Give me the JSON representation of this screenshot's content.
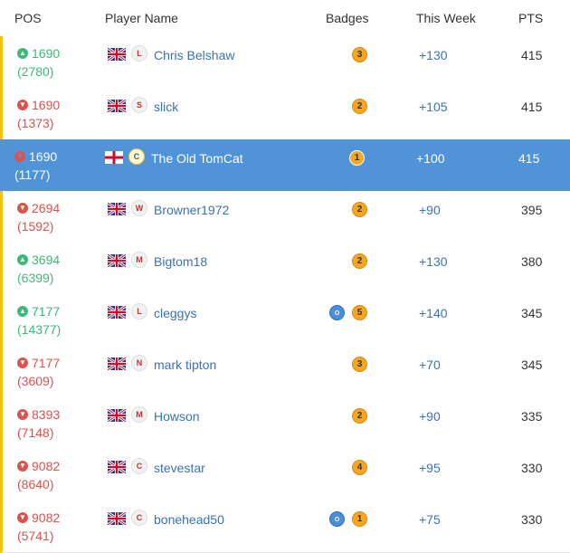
{
  "headers": {
    "pos": "POS",
    "name": "Player Name",
    "badges": "Badges",
    "week": "This Week",
    "pts": "PTS"
  },
  "rows": [
    {
      "pos": "1690",
      "prev": "(2780)",
      "dir": "up",
      "flag": "uk",
      "crest": "liverpool",
      "name": "Chris Belshaw",
      "badge": "3",
      "extra_badge": false,
      "week": "+130",
      "pts": "415",
      "stripe": true,
      "active": false
    },
    {
      "pos": "1690",
      "prev": "(1373)",
      "dir": "down",
      "flag": "uk",
      "crest": "spurs",
      "name": "slick",
      "badge": "2",
      "extra_badge": false,
      "week": "+105",
      "pts": "415",
      "stripe": true,
      "active": false
    },
    {
      "pos": "1690",
      "prev": "(1177)",
      "dir": "down",
      "flag": "england",
      "crest": "club",
      "name": "The Old TomCat",
      "badge": "1",
      "extra_badge": false,
      "week": "+100",
      "pts": "415",
      "stripe": false,
      "active": true
    },
    {
      "pos": "2694",
      "prev": "(1592)",
      "dir": "down",
      "flag": "uk",
      "crest": "westham",
      "name": "Browner1972",
      "badge": "2",
      "extra_badge": false,
      "week": "+90",
      "pts": "395",
      "stripe": true,
      "active": false
    },
    {
      "pos": "3694",
      "prev": "(6399)",
      "dir": "up",
      "flag": "uk",
      "crest": "manutd",
      "name": "Bigtom18",
      "badge": "2",
      "extra_badge": false,
      "week": "+130",
      "pts": "380",
      "stripe": true,
      "active": false
    },
    {
      "pos": "7177",
      "prev": "(14377)",
      "dir": "up",
      "flag": "uk",
      "crest": "liverpool",
      "name": "cleggys",
      "badge": "5",
      "extra_badge": true,
      "week": "+140",
      "pts": "345",
      "stripe": true,
      "active": false
    },
    {
      "pos": "7177",
      "prev": "(3609)",
      "dir": "down",
      "flag": "uk",
      "crest": "forest",
      "name": "mark tipton",
      "badge": "3",
      "extra_badge": false,
      "week": "+70",
      "pts": "345",
      "stripe": true,
      "active": false
    },
    {
      "pos": "8393",
      "prev": "(7148)",
      "dir": "down",
      "flag": "uk",
      "crest": "manutd",
      "name": "Howson",
      "badge": "2",
      "extra_badge": false,
      "week": "+90",
      "pts": "335",
      "stripe": true,
      "active": false
    },
    {
      "pos": "9082",
      "prev": "(8640)",
      "dir": "down",
      "flag": "uk",
      "crest": "cheltenham",
      "name": "stevestar",
      "badge": "4",
      "extra_badge": false,
      "week": "+95",
      "pts": "330",
      "stripe": true,
      "active": false
    },
    {
      "pos": "9082",
      "prev": "(5741)",
      "dir": "down",
      "flag": "uk",
      "crest": "cheltenham",
      "name": "bonehead50",
      "badge": "1",
      "extra_badge": true,
      "week": "+75",
      "pts": "330",
      "stripe": true,
      "active": false
    }
  ],
  "colors": {
    "up": "#3cb878",
    "down": "#d9534f",
    "highlight": "#5093d7",
    "link": "#3a73b2",
    "stripe": "#f1c40f",
    "badge": "#f5a623"
  }
}
